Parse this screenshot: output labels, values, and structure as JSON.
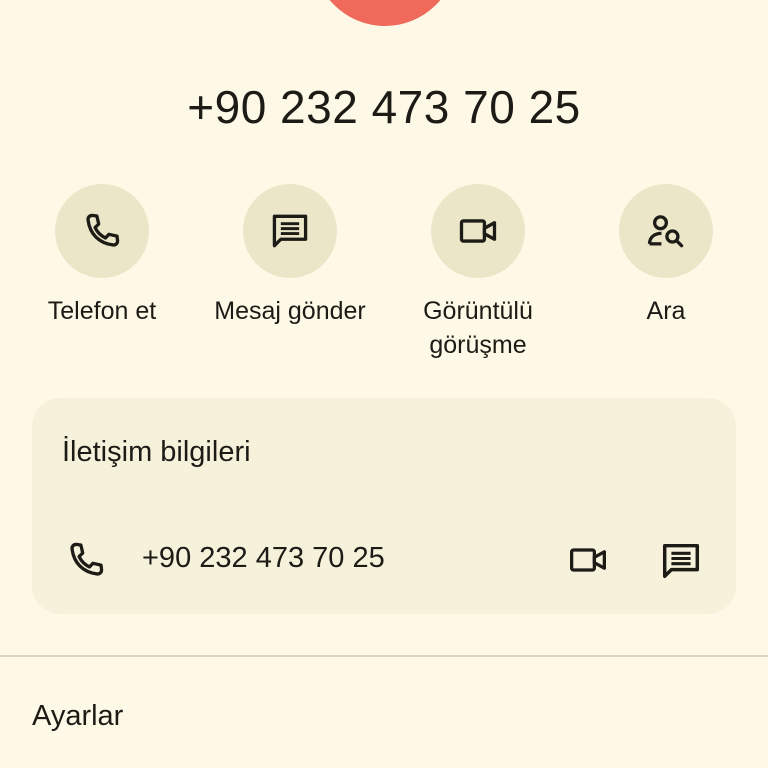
{
  "contact": {
    "avatar_color": "#ef6a5b",
    "phone_number": "+90 232 473 70 25"
  },
  "actions": [
    {
      "label": "Telefon et",
      "icon": "phone-icon"
    },
    {
      "label": "Mesaj gönder",
      "icon": "message-icon"
    },
    {
      "label": "Görüntülü görüşme",
      "icon": "video-call-icon"
    },
    {
      "label": "Ara",
      "icon": "person-search-icon"
    }
  ],
  "contact_info": {
    "title": "İletişim bilgileri",
    "phone": "+90 232 473 70 25",
    "icons": [
      "phone-icon",
      "video-call-icon",
      "message-icon"
    ]
  },
  "settings": {
    "label": "Ayarlar"
  },
  "colors": {
    "background": "#fdf9e6",
    "action_circle": "#ebe6c8",
    "card": "#f6f1da",
    "text": "#1d1b16"
  }
}
